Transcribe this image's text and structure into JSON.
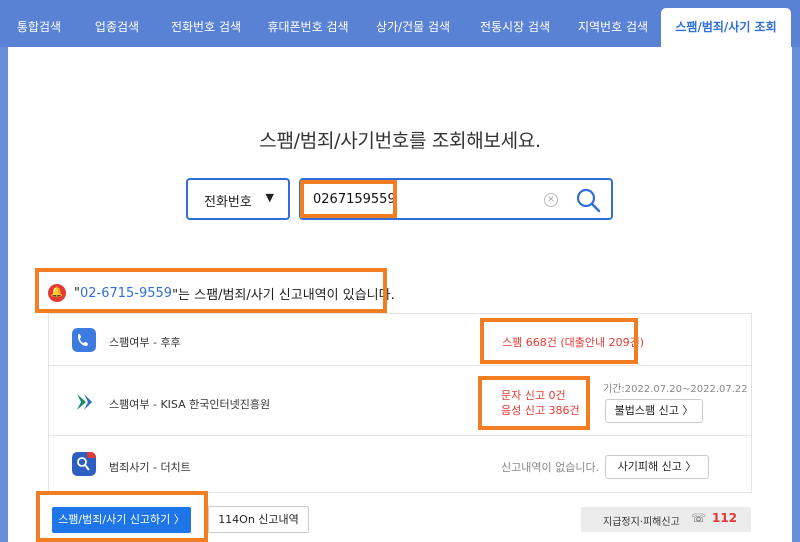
{
  "tabs": [
    {
      "label": "통합검색"
    },
    {
      "label": "업종검색"
    },
    {
      "label": "전화번호 검색"
    },
    {
      "label": "휴대폰번호 검색"
    },
    {
      "label": "상가/건물 검색"
    },
    {
      "label": "전통시장 검색"
    },
    {
      "label": "지역번호 검색"
    },
    {
      "label": "스팸/범죄/사기 조회"
    }
  ],
  "headline": "스팸/범죄/사기번호를 조회해보세요.",
  "search": {
    "type_label": "전화번호",
    "value": "0267159559",
    "clear_glyph": "✕"
  },
  "alert": {
    "quote_open": "\"",
    "number": "02-6715-9559",
    "message": "\"는 스팸/범죄/사기 신고내역이 있습니다."
  },
  "results": [
    {
      "label": "스팸여부 - 후후",
      "result": "스팸 668건 (대출안내 209건)"
    },
    {
      "label": "스팸여부 - KISA 한국인터넷진흥원",
      "result_line1": "문자 신고 0건",
      "result_line2": "음성 신고 386건",
      "period": "기간:2022.07.20~2022.07.22",
      "button": "불법스팸 신고 〉"
    },
    {
      "label": "범죄사기 - 더치트",
      "result": "신고내역이 없습니다.",
      "button": "사기피해 신고 〉"
    }
  ],
  "bottom": {
    "report_button": "스팸/범죄/사기 신고하기 〉",
    "history_button": "114On 신고내역",
    "stop_report": "지급정지·피해신고",
    "phone_glyph": "☏",
    "police_number": "112"
  },
  "colors": {
    "tab_bar": "#5a82d4",
    "accent_blue": "#2f6fd9",
    "alert_red": "#e53935",
    "highlight_orange": "#f27d22",
    "button_blue": "#1e75e8"
  },
  "icons": {
    "whowho": "phone-icon",
    "kisa": "kisa-logo-icon",
    "thecheat": "thecheat-logo-icon",
    "search": "search-icon",
    "bell": "bell-icon"
  }
}
